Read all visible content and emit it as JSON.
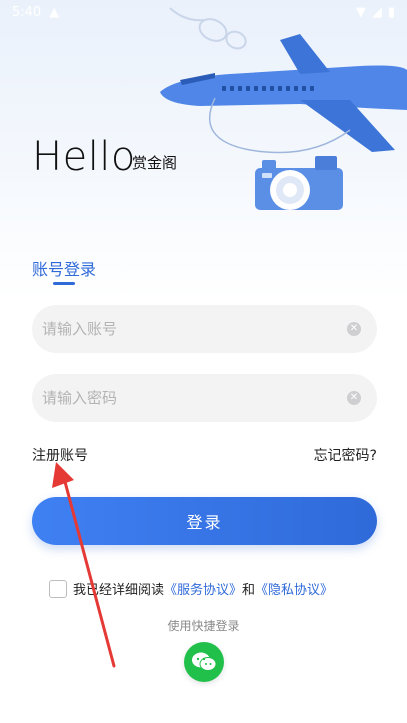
{
  "status_bar": {
    "time": "5:40"
  },
  "header": {
    "greeting": "Hello",
    "brand": "赏金阁"
  },
  "tabs": {
    "login_tab": "账号登录"
  },
  "form": {
    "account_placeholder": "请输入账号",
    "password_placeholder": "请输入密码",
    "register_link": "注册账号",
    "forgot_link": "忘记密码?",
    "login_button": "登录"
  },
  "agreement": {
    "prefix": "我已经详细阅读",
    "service_link": "《服务协议》",
    "and": "和",
    "privacy_link": "《隐私协议》"
  },
  "quick_login": {
    "label": "使用快捷登录",
    "wechat_icon": "wechat-icon"
  },
  "colors": {
    "accent": "#2f6ad9",
    "wechat": "#21c04b",
    "annotation_arrow": "#e53935"
  }
}
